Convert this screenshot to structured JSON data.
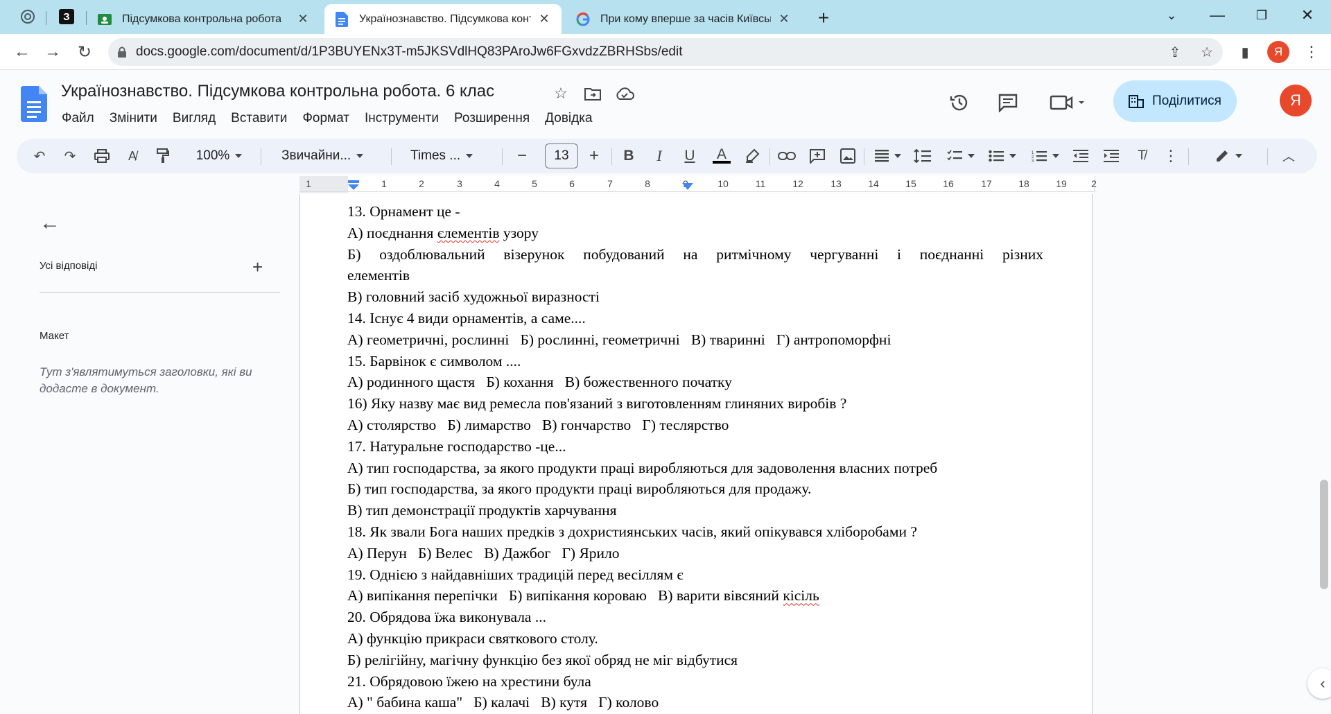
{
  "browser": {
    "tabs": [
      {
        "label": "Підсумкова контрольна робота",
        "active": false
      },
      {
        "label": "Українознавство. Підсумкова конт",
        "active": true
      },
      {
        "label": "При кому вперше за часів Київськ",
        "active": false
      }
    ],
    "mini_tab_label": "З",
    "url": "docs.google.com/document/d/1P3BUYENx3T-m5JKSVdlHQ83PAroJw6FGxvdzZBRHSbs/edit",
    "profile_initial": "Я"
  },
  "doc": {
    "title": "Українознавство. Підсумкова контрольна робота. 6 клас",
    "menu": [
      "Файл",
      "Змінити",
      "Вигляд",
      "Вставити",
      "Формат",
      "Інструменти",
      "Розширення",
      "Довідка"
    ],
    "share_label": "Поділитися",
    "user_initial": "Я"
  },
  "toolbar": {
    "zoom": "100%",
    "style": "Звичайни...",
    "font": "Times ...",
    "font_size": "13"
  },
  "ruler": {
    "numbers": [
      "1",
      "1",
      "2",
      "3",
      "4",
      "5",
      "6",
      "7",
      "8",
      "9",
      "10",
      "11",
      "12",
      "13",
      "14",
      "15",
      "16",
      "17",
      "18",
      "19",
      "2"
    ]
  },
  "outline": {
    "all_answers": "Усі відповіді",
    "layout_heading": "Макет",
    "hint": "Тут з'являтимуться заголовки, які ви додасте в документ."
  },
  "body": {
    "lines": [
      {
        "text": "13. Орнамент це -"
      },
      {
        "pre": "А) поєднання ",
        "spell": "єлементів",
        "post": " узору"
      },
      {
        "text": "Б) оздоблювальний візерунок побудований на ритмічному чергуванні і поєднанні різних",
        "justify": true
      },
      {
        "text": "елементів",
        "cont": true
      },
      {
        "text": "В) головний засіб художньої виразності"
      },
      {
        "text": "14. Існує 4 види орнаментів, а саме...."
      },
      {
        "text": "А) геометричні, рослинні   Б) рослинні, геометричні   В) тваринні   Г) антропоморфні"
      },
      {
        "text": "15. Барвінок є символом ...."
      },
      {
        "text": "А) родинного щастя   Б) кохання   В) божественного початку"
      },
      {
        "text": "16) Яку назву має вид ремесла пов'язаний з виготовленням глиняних виробів ?"
      },
      {
        "text": "А) столярство   Б) лимарство   В) гончарство   Г) теслярство"
      },
      {
        "text": "17. Натуральне господарство -це..."
      },
      {
        "text": "А) тип господарства, за якого продукти праці виробляються для задоволення власних потреб"
      },
      {
        "text": "Б) тип господарства, за якого продукти праці виробляються для продажу."
      },
      {
        "text": "В) тип демонстрації продуктів харчування"
      },
      {
        "text": "18. Як звали Бога наших предків з дохристиянських часів, який опікувався хліборобами ?"
      },
      {
        "text": "А) Перун   Б) Велес   В) Дажбог   Г) Ярило"
      },
      {
        "text": "19. Однією з найдавніших традицій перед весіллям є"
      },
      {
        "pre": "А) випікання перепічки   Б) випікання короваю   В) варити вівсяний ",
        "spell": "кісіль",
        "post": ""
      },
      {
        "text": "20. Обрядова їжа виконувала ..."
      },
      {
        "text": "А) функцію прикраси святкового столу."
      },
      {
        "text": "Б) релігійну, магічну функцію без якої обряд не міг відбутися"
      },
      {
        "text": "21. Обрядовою їжею на хрестини була"
      },
      {
        "text": "А) \" бабина каша\"   Б) калачі   В) кутя   Г) колово"
      }
    ]
  }
}
